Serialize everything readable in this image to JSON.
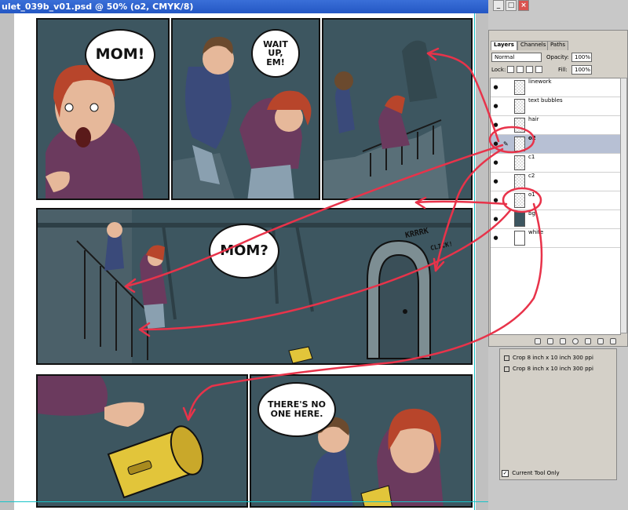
{
  "document": {
    "title": "ulet_039b_v01.psd @ 50% (o2, CMYK/8)"
  },
  "window_controls": {
    "minimize": "_",
    "maximize": "□",
    "close": "×"
  },
  "comic": {
    "bubble_mom_1": "MOM!",
    "bubble_wait_up": "WAIT UP, EM!",
    "bubble_mom_2": "MOM?",
    "sfx_krrrk": "KRRRK",
    "sfx_click": "CLICK!",
    "bubble_no_one": "THERE'S NO ONE HERE."
  },
  "layers_panel": {
    "tabs": [
      "Layers",
      "Channels",
      "Paths"
    ],
    "blend_mode": "Normal",
    "opacity_label": "Opacity:",
    "opacity_value": "100%",
    "lock_label": "Lock:",
    "fill_label": "Fill:",
    "fill_value": "100%",
    "layers": [
      {
        "name": "linework",
        "selected": false
      },
      {
        "name": "text bubbles",
        "selected": false
      },
      {
        "name": "hair",
        "selected": false
      },
      {
        "name": "o2",
        "selected": true
      },
      {
        "name": "c1",
        "selected": false
      },
      {
        "name": "c2",
        "selected": false
      },
      {
        "name": "o1",
        "selected": false
      },
      {
        "name": "bg",
        "selected": false
      },
      {
        "name": "white",
        "selected": false
      }
    ]
  },
  "history_panel": {
    "items": [
      "Crop 8 inch x 10 inch 300 ppi",
      "Crop 8 inch x 10 inch 300 ppi"
    ],
    "current_tool_only": "Current Tool Only"
  },
  "colors": {
    "annotation_red": "#e8334a",
    "panel_bg": "#3d5660",
    "guide_cyan": "#19c3c8",
    "hair_red": "#b8452b",
    "hoodie_purple": "#6b3a5e",
    "flashlight_yellow": "#e2c53a"
  }
}
